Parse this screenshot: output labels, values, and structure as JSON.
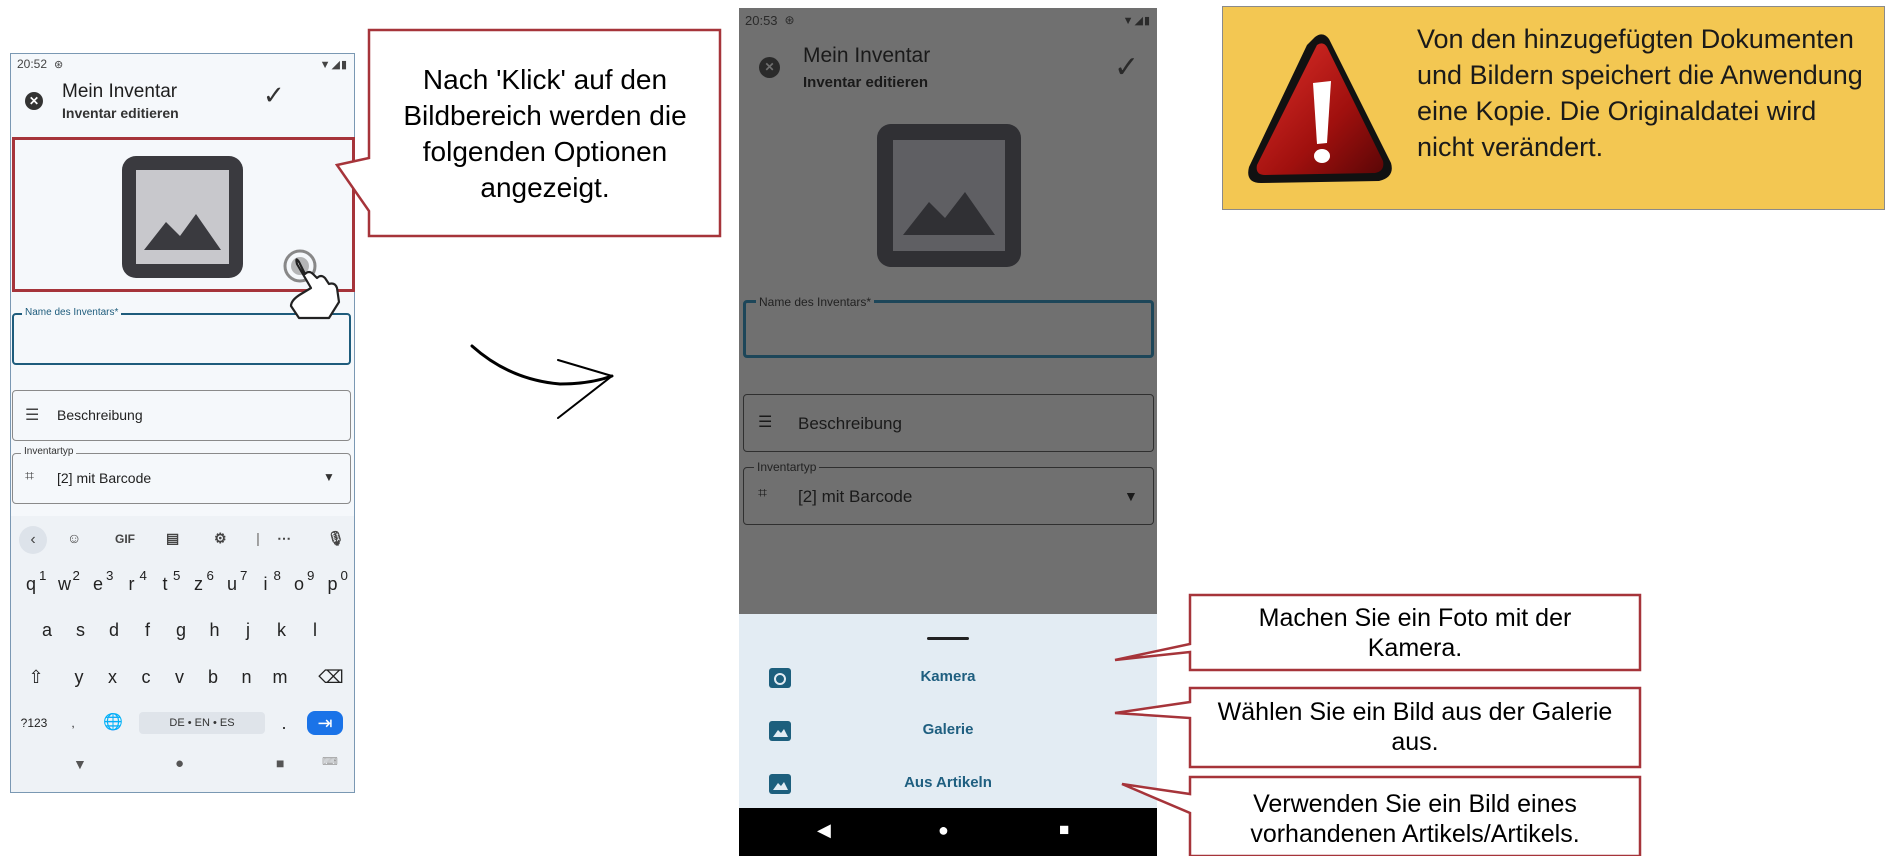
{
  "phone1": {
    "status_time": "20:52",
    "title": "Mein Inventar",
    "subtitle": "Inventar editieren",
    "name_label": "Name des Inventars*",
    "description_placeholder": "Beschreibung",
    "type_label": "Inventartyp",
    "type_value": "[2] mit Barcode",
    "keyboard": {
      "gif_label": "GIF",
      "row1": [
        "q",
        "w",
        "e",
        "r",
        "t",
        "z",
        "u",
        "i",
        "o",
        "p"
      ],
      "row1_hints": [
        "1",
        "2",
        "3",
        "4",
        "5",
        "6",
        "7",
        "8",
        "9",
        "0"
      ],
      "row2": [
        "a",
        "s",
        "d",
        "f",
        "g",
        "h",
        "j",
        "k",
        "l"
      ],
      "row3": [
        "y",
        "x",
        "c",
        "v",
        "b",
        "n",
        "m"
      ],
      "symbols_label": "?123",
      "space_label": "DE • EN • ES",
      "period_label": "."
    }
  },
  "callout_click": "Nach 'Klick' auf den Bildbereich werden die folgenden Optionen angezeigt.",
  "phone2": {
    "status_time": "20:53",
    "title": "Mein Inventar",
    "subtitle": "Inventar editieren",
    "name_label": "Name des Inventars*",
    "description_placeholder": "Beschreibung",
    "type_label": "Inventartyp",
    "type_value": "[2] mit Barcode",
    "options": [
      {
        "label": "Kamera",
        "icon": "camera-icon"
      },
      {
        "label": "Galerie",
        "icon": "image-icon"
      },
      {
        "label": "Aus Artikeln",
        "icon": "image-icon"
      }
    ]
  },
  "warning": {
    "icon": "warning-triangle-icon",
    "text": "Von den hinzugefügten Dokumenten und Bildern speichert die Anwendung eine Kopie. Die Originaldatei wird nicht verändert."
  },
  "callouts": {
    "camera": "Machen Sie ein Foto mit der Kamera.",
    "gallery": "Wählen Sie ein Bild aus der Galerie aus.",
    "articles": "Verwenden Sie ein Bild eines vorhandenen Artikels/Artikels."
  },
  "colors": {
    "callout_border": "#a6343a",
    "warning_bg": "#f3c752",
    "accent": "#1d5f7d",
    "keyboard_enter": "#1a73e8"
  }
}
